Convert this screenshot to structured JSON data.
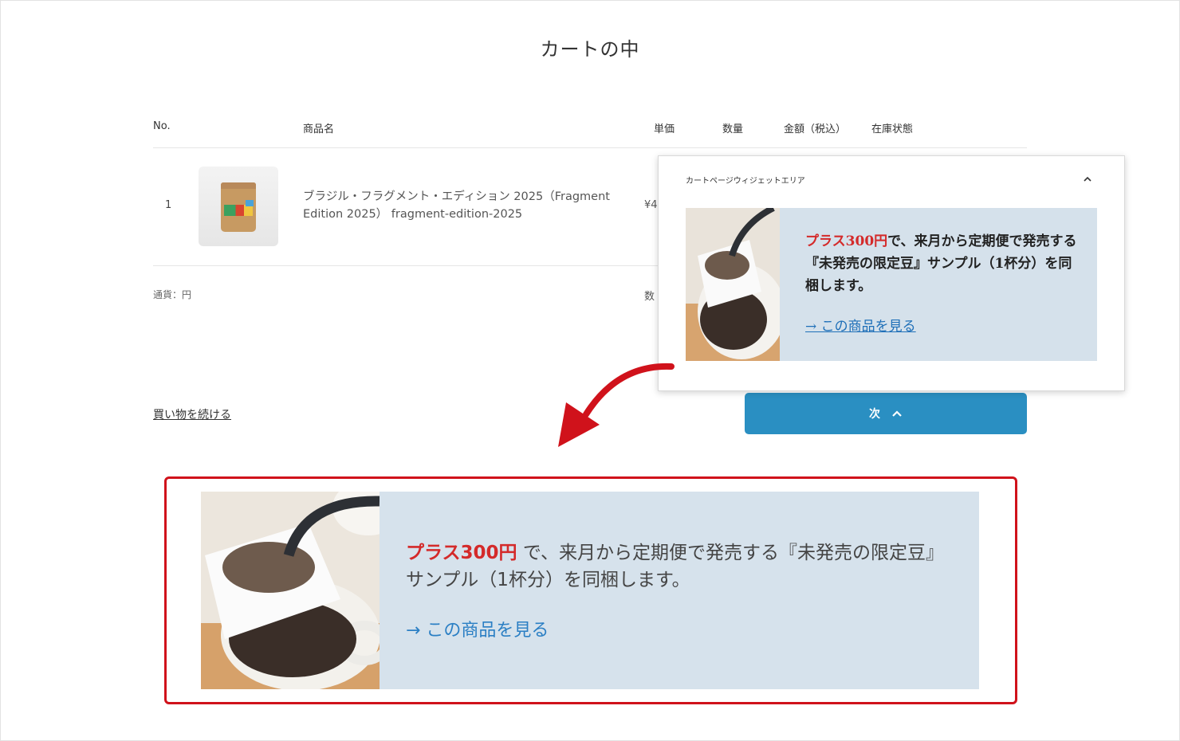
{
  "page": {
    "title": "カートの中"
  },
  "table": {
    "headers": {
      "no": "No.",
      "name": "商品名",
      "unit_price": "単価",
      "quantity": "数量",
      "amount": "金額（税込）",
      "stock": "在庫状態"
    },
    "row": {
      "no": "1",
      "name": "ブラジル・フラグメント・エディション 2025（Fragment Edition 2025） fragment-edition-2025",
      "price_peek": "¥4"
    }
  },
  "summary": {
    "currency": "通貨：円",
    "qty_peek": "数"
  },
  "actions": {
    "continue_shopping": "買い物を続ける",
    "next_label": "次",
    "next_chevron": "^"
  },
  "widget": {
    "heading": "カートページウィジェットエリア",
    "chevron": "^",
    "accent_text": "プラス300円",
    "body_text": "で、来月から定期便で発売する『未発売の限定豆』サンプル（1杯分）を同梱します。",
    "link_text": "→ この商品を見る"
  },
  "preview": {
    "accent_text": "プラス300円",
    "body_text": " で、来月から定期便で発売する『未発売の限定豆』サンプル（1杯分）を同梱します。",
    "link_text": "→ この商品を見る"
  },
  "colors": {
    "accent_red": "#d42a2a",
    "highlight_border": "#d0121b",
    "button_blue": "#2a8fc2",
    "banner_bg": "#d6e2ec",
    "link_blue": "#1e6fb8"
  },
  "icons": {
    "widget_collapse": "chevron-up-icon",
    "next": "chevron-up-icon",
    "callout": "curved-arrow-icon"
  }
}
